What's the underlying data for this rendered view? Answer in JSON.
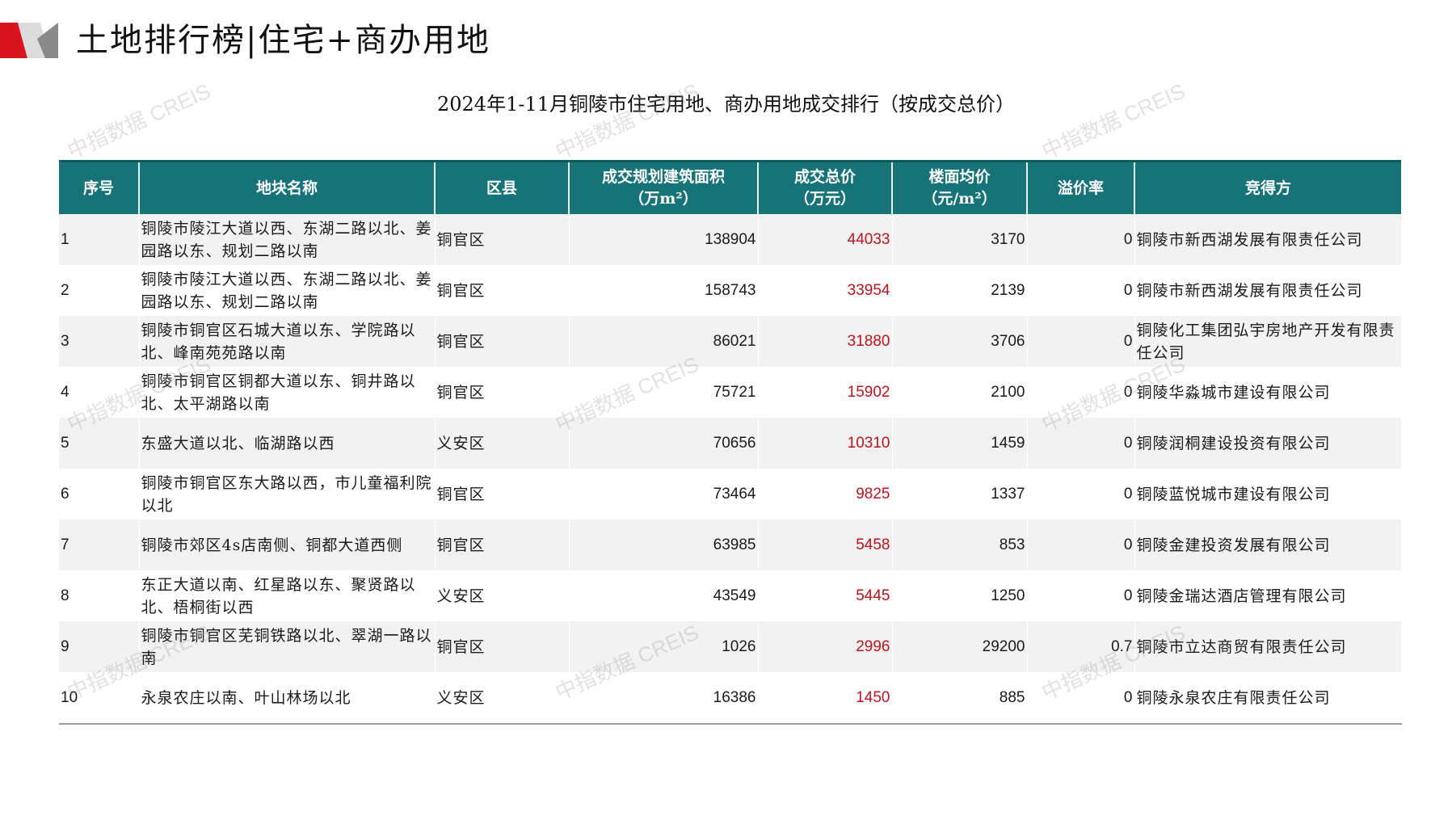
{
  "page": {
    "title": "土地排行榜|住宅+商办用地",
    "accent_color": "#d8141f",
    "header_color": "#167479",
    "price_color": "#c0121c"
  },
  "watermark": "中指数据 CREIS",
  "table": {
    "title": "2024年1-11月铜陵市住宅用地、商办用地成交排行（按成交总价）",
    "columns": [
      "序号",
      "地块名称",
      "区县",
      "成交规划建筑面积\n（万m²）",
      "成交总价\n（万元）",
      "楼面均价\n（元/m²）",
      "溢价率",
      "竞得方"
    ],
    "rows": [
      {
        "rank": "1",
        "name": "铜陵市陵江大道以西、东湖二路以北、姜园路以东、规划二路以南",
        "district": "铜官区",
        "area": "138904",
        "total": "44033",
        "unit_price": "3170",
        "premium": "0",
        "buyer": "铜陵市新西湖发展有限责任公司"
      },
      {
        "rank": "2",
        "name": "铜陵市陵江大道以西、东湖二路以北、姜园路以东、规划二路以南",
        "district": "铜官区",
        "area": "158743",
        "total": "33954",
        "unit_price": "2139",
        "premium": "0",
        "buyer": "铜陵市新西湖发展有限责任公司"
      },
      {
        "rank": "3",
        "name": "铜陵市铜官区石城大道以东、学院路以北、峰南苑苑路以南",
        "district": "铜官区",
        "area": "86021",
        "total": "31880",
        "unit_price": "3706",
        "premium": "0",
        "buyer": "铜陵化工集团弘宇房地产开发有限责任公司"
      },
      {
        "rank": "4",
        "name": "铜陵市铜官区铜都大道以东、铜井路以北、太平湖路以南",
        "district": "铜官区",
        "area": "75721",
        "total": "15902",
        "unit_price": "2100",
        "premium": "0",
        "buyer": "铜陵华淼城市建设有限公司"
      },
      {
        "rank": "5",
        "name": "东盛大道以北、临湖路以西",
        "district": "义安区",
        "area": "70656",
        "total": "10310",
        "unit_price": "1459",
        "premium": "0",
        "buyer": "铜陵润桐建设投资有限公司"
      },
      {
        "rank": "6",
        "name": "铜陵市铜官区东大路以西，市儿童福利院以北",
        "district": "铜官区",
        "area": "73464",
        "total": "9825",
        "unit_price": "1337",
        "premium": "0",
        "buyer": "铜陵蓝悦城市建设有限公司"
      },
      {
        "rank": "7",
        "name": "铜陵市郊区4s店南侧、铜都大道西侧",
        "district": "铜官区",
        "area": "63985",
        "total": "5458",
        "unit_price": "853",
        "premium": "0",
        "buyer": "铜陵金建投资发展有限公司"
      },
      {
        "rank": "8",
        "name": "东正大道以南、红星路以东、聚贤路以北、梧桐街以西",
        "district": "义安区",
        "area": "43549",
        "total": "5445",
        "unit_price": "1250",
        "premium": "0",
        "buyer": "铜陵金瑞达酒店管理有限公司"
      },
      {
        "rank": "9",
        "name": "铜陵市铜官区芜铜铁路以北、翠湖一路以南",
        "district": "铜官区",
        "area": "1026",
        "total": "2996",
        "unit_price": "29200",
        "premium": "0.7",
        "buyer": "铜陵市立达商贸有限责任公司"
      },
      {
        "rank": "10",
        "name": "永泉农庄以南、叶山林场以北",
        "district": "义安区",
        "area": "16386",
        "total": "1450",
        "unit_price": "885",
        "premium": "0",
        "buyer": "铜陵永泉农庄有限责任公司"
      }
    ]
  }
}
